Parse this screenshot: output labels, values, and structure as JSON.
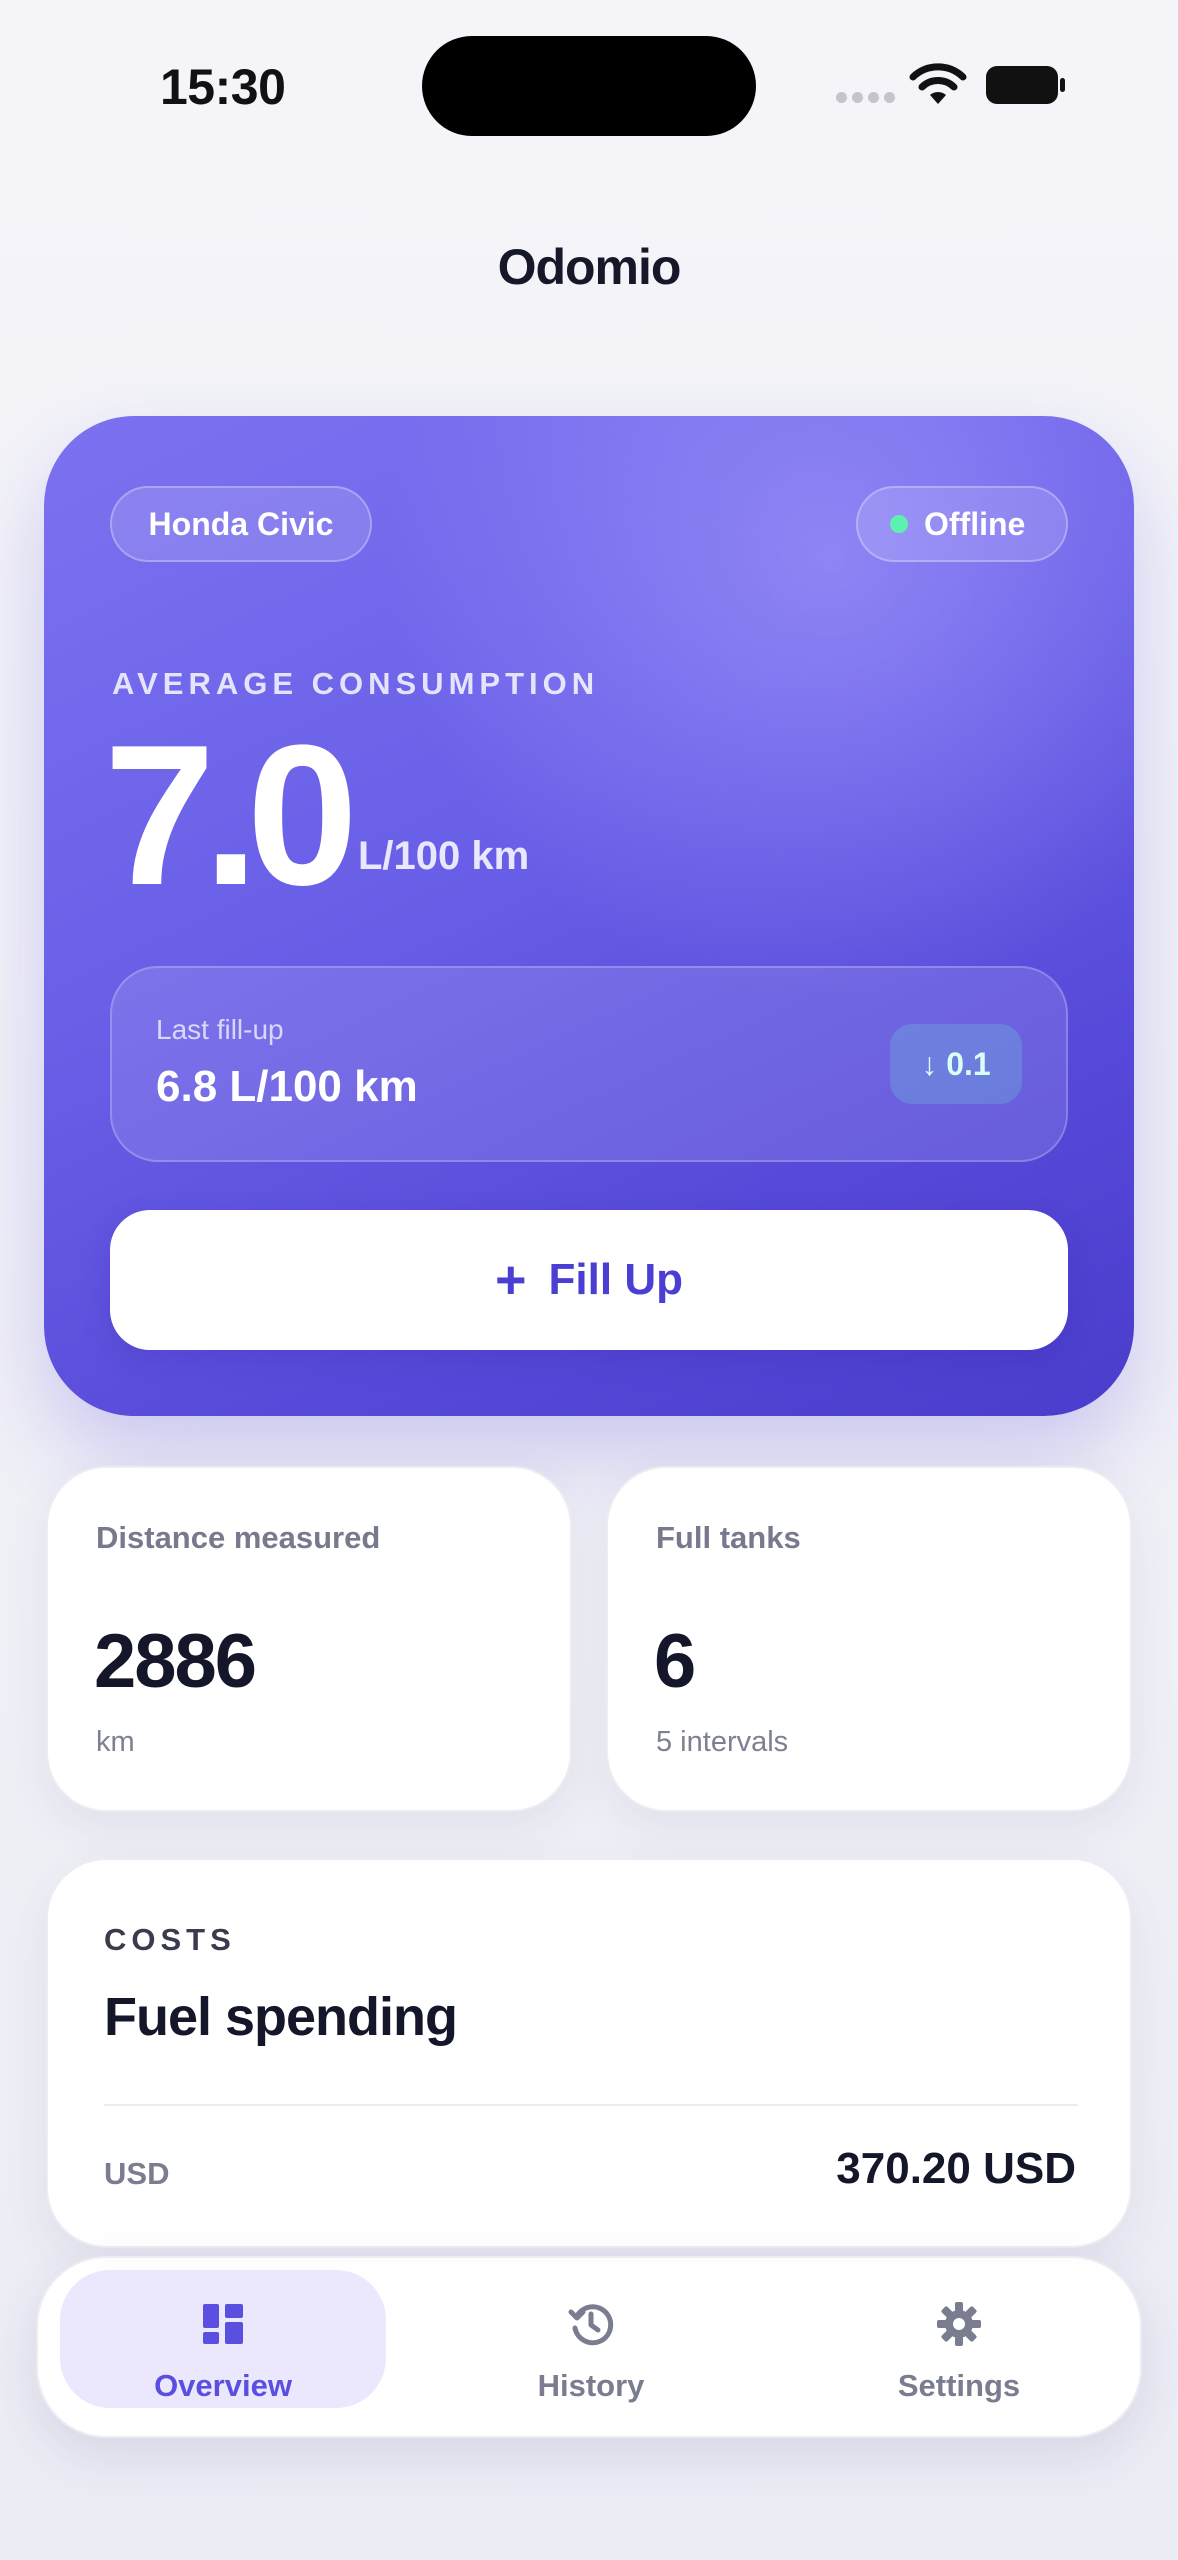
{
  "status_bar": {
    "time": "15:30"
  },
  "app": {
    "title": "Odomio"
  },
  "hero": {
    "vehicle": "Honda Civic",
    "connection_status": "Offline",
    "label": "AVERAGE CONSUMPTION",
    "value": "7.0",
    "unit": "L/100 km",
    "last_fill": {
      "label": "Last fill-up",
      "value": "6.8 L/100 km",
      "delta": "↓ 0.1"
    },
    "fill_button": {
      "icon": "+",
      "label": "Fill Up"
    }
  },
  "stats": {
    "distance": {
      "title": "Distance measured",
      "value": "2886",
      "sub": "km"
    },
    "tanks": {
      "title": "Full tanks",
      "value": "6",
      "sub": "5 intervals"
    }
  },
  "costs": {
    "eyebrow": "COSTS",
    "heading": "Fuel spending",
    "currency": "USD",
    "amount": "370.20 USD"
  },
  "tabs": [
    {
      "label": "Overview",
      "icon": "dashboard-icon",
      "active": true
    },
    {
      "label": "History",
      "icon": "history-icon",
      "active": false
    },
    {
      "label": "Settings",
      "icon": "gear-icon",
      "active": false
    }
  ],
  "colors": {
    "accent": "#6a60e8",
    "status_dot": "#5ef0b0"
  }
}
